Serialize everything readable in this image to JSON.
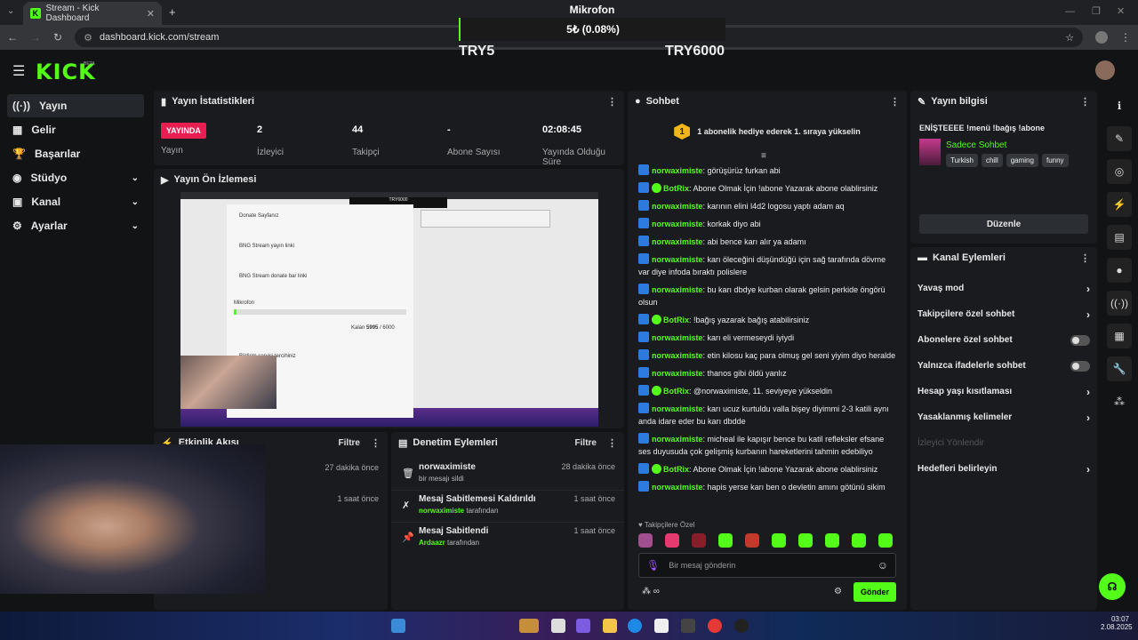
{
  "browser": {
    "tab_title": "Stream - Kick Dashboard",
    "url": "dashboard.kick.com/stream"
  },
  "overlay": {
    "title": "Mikrofon",
    "amount": "5₺ (0.08%)",
    "goal_min": "TRY5",
    "goal_max": "TRY6000",
    "progress_fraction": 0.0008
  },
  "brand": {
    "logo": "KICK",
    "beta": "BETA"
  },
  "sidebar": {
    "items": [
      {
        "label": "Yayın",
        "icon": "broadcast-icon"
      },
      {
        "label": "Gelir",
        "icon": "revenue-icon"
      },
      {
        "label": "Başarılar",
        "icon": "trophy-icon"
      },
      {
        "label": "Stüdyo",
        "icon": "studio-icon"
      },
      {
        "label": "Kanal",
        "icon": "channel-icon"
      },
      {
        "label": "Ayarlar",
        "icon": "gear-icon"
      }
    ]
  },
  "stats": {
    "title": "Yayın İstatistikleri",
    "live_badge": "YAYINDA",
    "live_label": "Yayın",
    "viewers_value": "2",
    "viewers_label": "İzleyici",
    "followers_value": "44",
    "followers_label": "Takipçi",
    "subs_value": "-",
    "subs_label": "Abone Sayısı",
    "uptime_value": "02:08:45",
    "uptime_label": "Yayında Olduğu Süre"
  },
  "preview": {
    "title": "Yayın Ön İzlemesi",
    "inner": {
      "donate_page": "Donate Sayfanız",
      "stream_link": "BNG Stream yayın linki",
      "donate_link": "BNG Stream donate bar linki",
      "mic_label": "Mikrofon",
      "amount_label": "Kalan",
      "amount_value": "5995",
      "amount_goal": "/ 6000",
      "service": "Bildirim servisi tercihiniz",
      "goal": "TRY6000"
    }
  },
  "activity": {
    "title": "Etkinlik Akışı",
    "filter": "Filtre",
    "times": [
      "27 dakika önce",
      "1 saat önce"
    ]
  },
  "moderation": {
    "title": "Denetim Eylemleri",
    "filter": "Filtre",
    "items": [
      {
        "title": "norwaximiste",
        "sub_user": "",
        "sub": "bir mesajı sildi",
        "time": "28 dakika önce",
        "icon": "trash-icon"
      },
      {
        "title": "Mesaj Sabitlemesi Kaldırıldı",
        "sub_user": "norwaximiste",
        "sub": "tarafından",
        "time": "1 saat önce",
        "icon": "unpin-icon"
      },
      {
        "title": "Mesaj Sabitlendi",
        "sub_user": "Ardaazr",
        "sub": "tarafından",
        "time": "1 saat önce",
        "icon": "pin-icon"
      }
    ]
  },
  "chat": {
    "title": "Sohbet",
    "pinned": "1 abonelik hediye ederek 1. sıraya yükselin",
    "pinned_rank": "1",
    "messages": [
      {
        "user": "norwaximiste",
        "text": "görüşürüz furkan abi",
        "bot": false
      },
      {
        "user": "BotRix",
        "text": "Abone Olmak İçin !abone Yazarak abone olablirsiniz",
        "bot": true
      },
      {
        "user": "norwaximiste",
        "text": "karının elini l4d2 logosu yaptı adam aq",
        "bot": false
      },
      {
        "user": "norwaximiste",
        "text": "korkak diyo abi",
        "bot": false
      },
      {
        "user": "norwaximiste",
        "text": "abi bence karı alır ya adamı",
        "bot": false
      },
      {
        "user": "norwaximiste",
        "text": "karı öleceğini düşündüğü için sağ tarafında dövme var diye infoda bıraktı polislere",
        "bot": false
      },
      {
        "user": "norwaximiste",
        "text": "bu karı dbdye kurban olarak gelsin perkide öngörü olsun",
        "bot": false
      },
      {
        "user": "BotRix",
        "text": "!bağış yazarak bağış atabilirsiniz",
        "bot": true
      },
      {
        "user": "norwaximiste",
        "text": "karı eli vermeseydi iyiydi",
        "bot": false
      },
      {
        "user": "norwaximiste",
        "text": "etin kilosu kaç para olmuş gel seni yiyim diyo heralde",
        "bot": false
      },
      {
        "user": "norwaximiste",
        "text": "thanos gibi öldü yanlız",
        "bot": false
      },
      {
        "user": "BotRix",
        "text": "@norwaximiste, 11. seviyeye yükseldin",
        "bot": true
      },
      {
        "user": "norwaximiste",
        "text": "karı ucuz kurtuldu valla bişey diyimmi 2-3 katili aynı anda idare eder bu karı dbdde",
        "bot": false
      },
      {
        "user": "norwaximiste",
        "text": "micheal ile kapışır bence bu katil refleksler efsane ses duyusuda çok gelişmiş kurbanın hareketlerini tahmin edebiliyo",
        "bot": false
      },
      {
        "user": "BotRix",
        "text": "Abone Olmak İçin !abone Yazarak abone olablirsiniz",
        "bot": true
      },
      {
        "user": "norwaximiste",
        "text": "hapis yerse karı ben o devletin amını götünü sikim",
        "bot": false
      }
    ],
    "followers_only": "Takipçilere Özel",
    "input_placeholder": "Bir mesaj gönderin",
    "send": "Gönder",
    "bot_color": "#53fc18",
    "user_color": "#53fc18"
  },
  "stream_info": {
    "title": "Yayın bilgisi",
    "stream_title": "ENİŞTEEEE !menü !bağış !abone",
    "category": "Sadece Sohbet",
    "tags": [
      "Turkish",
      "chill",
      "gaming",
      "funny"
    ],
    "edit": "Düzenle"
  },
  "channel_actions": {
    "title": "Kanal Eylemleri",
    "items": [
      {
        "label": "Yavaş mod",
        "control": "chevron"
      },
      {
        "label": "Takipçilere özel sohbet",
        "control": "chevron"
      },
      {
        "label": "Abonelere özel sohbet",
        "control": "toggle"
      },
      {
        "label": "Yalnızca ifadelerle sohbet",
        "control": "toggle"
      },
      {
        "label": "Hesap yaşı kısıtlaması",
        "control": "chevron"
      },
      {
        "label": "Yasaklanmış kelimeler",
        "control": "chevron"
      },
      {
        "label": "İzleyici Yönlendir",
        "control": "none"
      },
      {
        "label": "Hedefleri belirleyin",
        "control": "chevron"
      }
    ]
  },
  "taskbar": {
    "time": "03:07",
    "date": "2.08.2025"
  },
  "colors": {
    "brand": "#53fc18",
    "live": "#e91e50",
    "panel": "#191b1f"
  }
}
